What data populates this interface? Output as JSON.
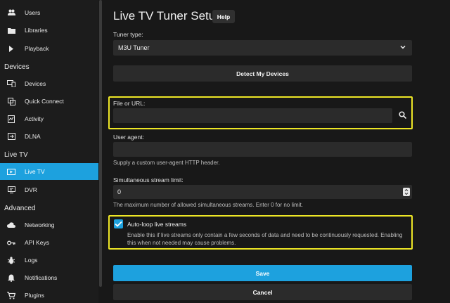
{
  "sidebar": {
    "items_top": [
      {
        "label": "Users",
        "icon": "users-icon"
      },
      {
        "label": "Libraries",
        "icon": "folder-icon"
      },
      {
        "label": "Playback",
        "icon": "play-icon"
      }
    ],
    "section_devices": "Devices",
    "items_devices": [
      {
        "label": "Devices",
        "icon": "devices-icon"
      },
      {
        "label": "Quick Connect",
        "icon": "link-icon"
      },
      {
        "label": "Activity",
        "icon": "activity-icon"
      },
      {
        "label": "DLNA",
        "icon": "dlna-icon"
      }
    ],
    "section_livetv": "Live TV",
    "items_livetv": [
      {
        "label": "Live TV",
        "icon": "live-tv-icon",
        "active": true
      },
      {
        "label": "DVR",
        "icon": "dvr-icon"
      }
    ],
    "section_advanced": "Advanced",
    "items_advanced": [
      {
        "label": "Networking",
        "icon": "cloud-icon"
      },
      {
        "label": "API Keys",
        "icon": "key-icon"
      },
      {
        "label": "Logs",
        "icon": "bug-icon"
      },
      {
        "label": "Notifications",
        "icon": "bell-icon"
      },
      {
        "label": "Plugins",
        "icon": "cart-icon"
      }
    ]
  },
  "page": {
    "title": "Live TV Tuner Setup",
    "help_label": "Help"
  },
  "form": {
    "tuner_type_label": "Tuner type:",
    "tuner_type_value": "M3U Tuner",
    "detect_label": "Detect My Devices",
    "file_url_label": "File or URL:",
    "file_url_value": "",
    "user_agent_label": "User agent:",
    "user_agent_value": "",
    "user_agent_hint": "Supply a custom user-agent HTTP header.",
    "stream_limit_label": "Simultaneous stream limit:",
    "stream_limit_value": "0",
    "stream_limit_hint": "The maximum number of allowed simultaneous streams. Enter 0 for no limit.",
    "autoloop_label": "Auto-loop live streams",
    "autoloop_checked": true,
    "autoloop_desc": "Enable this if live streams only contain a few seconds of data and need to be continuously requested. Enabling this when not needed may cause problems.",
    "save_label": "Save",
    "cancel_label": "Cancel"
  },
  "colors": {
    "accent": "#1da1de",
    "highlight": "#ede626",
    "background": "#181818",
    "field": "#2b2b2b"
  }
}
